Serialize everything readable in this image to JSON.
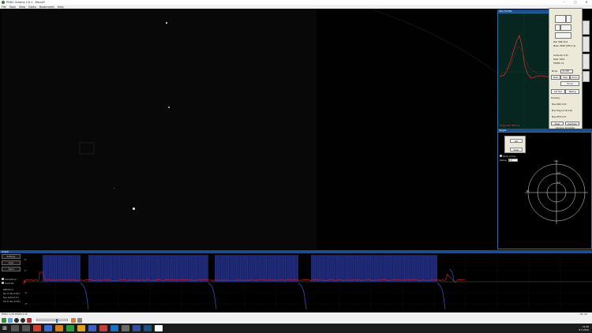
{
  "app": {
    "title": "PHD2 Guiding 2.6.1 - Mount?",
    "menus": [
      "File",
      "Tools",
      "View",
      "Darks",
      "Bookmarks",
      "Help"
    ]
  },
  "graph_panel": {
    "title": "Star Profile",
    "scale_text": "Guide star: HFD 2.4"
  },
  "control_panel": {
    "buttons": [
      "Start",
      "Stop",
      "Zoom",
      "Focus",
      "Cal Tool",
      "Testing"
    ],
    "texts": [
      "Star SNR 16.9",
      "Mass: 6508 (HFD 2.4)",
      "Guide RA 0.43",
      "Peak: 6451",
      "FWHM 2.9",
      "Mode",
      "Tracking"
    ],
    "field_value": "31,038",
    "stats": [
      "Max RMS 0.52",
      "Max Hdg+0.18 0.46",
      "Max HFD 0.57"
    ],
    "footer_buttons": [
      "Clear",
      "Pre-Track"
    ],
    "footer_text": "Camera: Simulator"
  },
  "target_panel": {
    "title": "Target",
    "mini_buttons": [
      "Set",
      "Clear"
    ],
    "checkbox_label": "Show circles",
    "radius_label": "Radius",
    "radius_value": "2.0",
    "labels": {
      "north": "Dec",
      "west": "RA",
      "inner": "1.0",
      "outer": "2.0"
    }
  },
  "guide_panel": {
    "title": "Graph",
    "buttons": [
      "Settings",
      "Clear",
      "Trend"
    ],
    "checkboxes": [
      "Corrections",
      "Trend RA"
    ],
    "stats": [
      "RMS Error:",
      "RA 17.46 (3.58\")",
      "Dec 0.00 (0.5\")",
      "Tot 17.46 (3.58\")"
    ]
  },
  "statusbar": {
    "left": "PHD2: 1.20 FWHM 2.35",
    "right": "No cal"
  },
  "taskbar": {
    "time": "22:46",
    "date": "8.5.2016",
    "start_glyph": "⊞"
  },
  "colors": {
    "panel_border": "#2b6fa8",
    "ra_trace": "#d01a2e",
    "dec_trace": "#3a57c9",
    "correction_fill": "#1f2a80",
    "graph_trace": "#c83232"
  },
  "guide_chart": {
    "ytick_labels": [
      "2\"",
      "1\"",
      "0",
      "-1\"",
      "-2\""
    ]
  }
}
